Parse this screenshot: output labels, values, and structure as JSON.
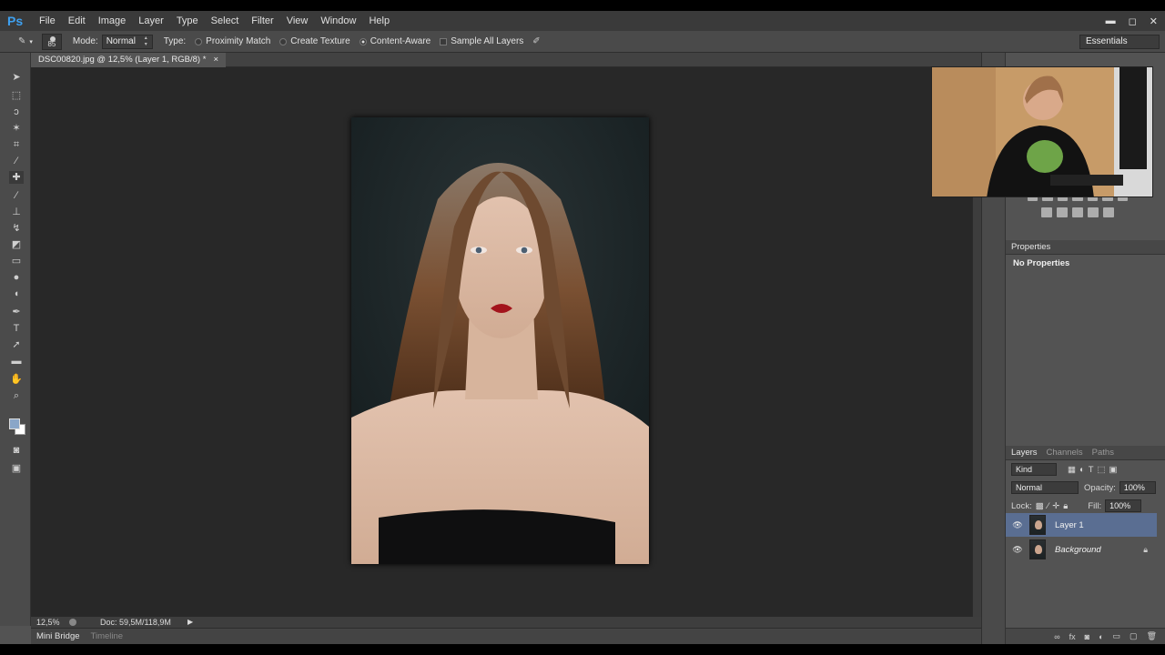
{
  "app": {
    "logo": "Ps",
    "menu": [
      "File",
      "Edit",
      "Image",
      "Layer",
      "Type",
      "Select",
      "Filter",
      "View",
      "Window",
      "Help"
    ]
  },
  "options": {
    "brush_size": "85",
    "mode_label": "Mode:",
    "mode_value": "Normal",
    "type_label": "Type:",
    "type_options": [
      "Proximity Match",
      "Create Texture",
      "Content-Aware"
    ],
    "sample_all_layers": "Sample All Layers",
    "workspace": "Essentials"
  },
  "document": {
    "tab_title": "DSC00820.jpg @ 12,5% (Layer 1, RGB/8) *",
    "tab_close": "×",
    "zoom": "12,5%",
    "doc_size": "Doc: 59,5M/118,9M"
  },
  "bottom_tabs": [
    "Mini Bridge",
    "Timeline"
  ],
  "panels": {
    "properties": {
      "title": "Properties",
      "body": "No Properties"
    },
    "layers": {
      "tabs": [
        "Layers",
        "Channels",
        "Paths"
      ],
      "kind": "Kind",
      "blend": "Normal",
      "opacity_label": "Opacity:",
      "opacity": "100%",
      "lock_label": "Lock:",
      "fill_label": "Fill:",
      "fill": "100%",
      "items": [
        {
          "name": "Layer 1",
          "selected": true
        },
        {
          "name": "Background",
          "selected": false
        }
      ]
    }
  }
}
